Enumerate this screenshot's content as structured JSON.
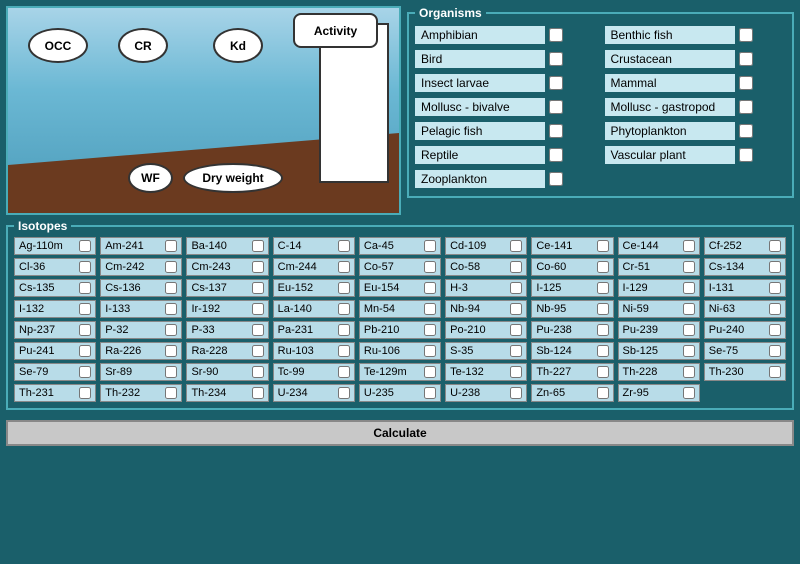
{
  "diagram": {
    "labels": {
      "occ": "OCC",
      "cr": "CR",
      "kd": "Kd",
      "activity": "Activity",
      "wf": "WF",
      "dry_weight": "Dry weight"
    }
  },
  "organisms": {
    "title": "Organisms",
    "items": [
      {
        "id": "amphibian",
        "label": "Amphibian",
        "checked": false
      },
      {
        "id": "benthic_fish",
        "label": "Benthic fish",
        "checked": false
      },
      {
        "id": "bird",
        "label": "Bird",
        "checked": false
      },
      {
        "id": "crustacean",
        "label": "Crustacean",
        "checked": false
      },
      {
        "id": "insect_larvae",
        "label": "Insect larvae",
        "checked": false
      },
      {
        "id": "mammal",
        "label": "Mammal",
        "checked": false
      },
      {
        "id": "mollusc_bivalve",
        "label": "Mollusc - bivalve",
        "checked": false
      },
      {
        "id": "mollusc_gastropod",
        "label": "Mollusc - gastropod",
        "checked": false
      },
      {
        "id": "pelagic_fish",
        "label": "Pelagic fish",
        "checked": false
      },
      {
        "id": "phytoplankton",
        "label": "Phytoplankton",
        "checked": false
      },
      {
        "id": "reptile",
        "label": "Reptile",
        "checked": false
      },
      {
        "id": "vascular_plant",
        "label": "Vascular plant",
        "checked": false
      },
      {
        "id": "zooplankton",
        "label": "Zooplankton",
        "checked": false
      }
    ]
  },
  "isotopes": {
    "title": "Isotopes",
    "items": [
      "Ag-110m",
      "Am-241",
      "Ba-140",
      "C-14",
      "Ca-45",
      "Cd-109",
      "Ce-141",
      "Ce-144",
      "Cf-252",
      "Cl-36",
      "Cm-242",
      "Cm-243",
      "Cm-244",
      "Co-57",
      "Co-58",
      "Co-60",
      "Cr-51",
      "Cs-134",
      "Cs-135",
      "Cs-136",
      "Cs-137",
      "Eu-152",
      "Eu-154",
      "H-3",
      "I-125",
      "I-129",
      "I-131",
      "I-132",
      "I-133",
      "Ir-192",
      "La-140",
      "Mn-54",
      "Nb-94",
      "Nb-95",
      "Ni-59",
      "Ni-63",
      "Np-237",
      "P-32",
      "P-33",
      "Pa-231",
      "Pb-210",
      "Po-210",
      "Pu-238",
      "Pu-239",
      "Pu-240",
      "Pu-241",
      "Ra-226",
      "Ra-228",
      "Ru-103",
      "Ru-106",
      "S-35",
      "Sb-124",
      "Sb-125",
      "Se-75",
      "Se-79",
      "Sr-89",
      "Sr-90",
      "Tc-99",
      "Te-129m",
      "Te-132",
      "Th-227",
      "Th-228",
      "Th-230",
      "Th-231",
      "Th-232",
      "Th-234",
      "U-234",
      "U-235",
      "U-238",
      "Zn-65",
      "Zr-95",
      ""
    ]
  },
  "buttons": {
    "calculate": "Calculate"
  }
}
